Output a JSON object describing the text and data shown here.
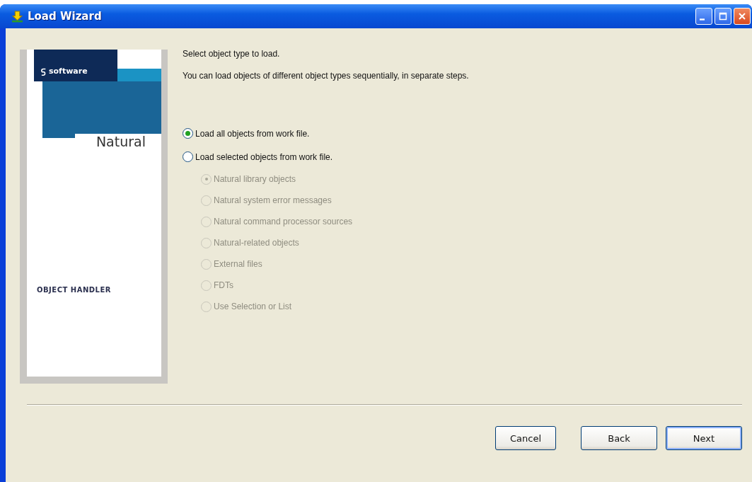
{
  "window": {
    "title": "Load Wizard"
  },
  "brand": {
    "company": "software",
    "product": "Natural",
    "module": "OBJECT HANDLER"
  },
  "heading": "Select object type to load.",
  "description": "You can load objects of different object types sequentially, in separate steps.",
  "options": [
    {
      "label": "Load all objects from work file.",
      "selected": true,
      "disabled": false
    },
    {
      "label": "Load selected objects from work file.",
      "selected": false,
      "disabled": false,
      "children": [
        {
          "label": "Natural library objects",
          "selected": true,
          "disabled": true
        },
        {
          "label": "Natural system error messages",
          "selected": false,
          "disabled": true
        },
        {
          "label": "Natural command processor sources",
          "selected": false,
          "disabled": true
        },
        {
          "label": "Natural-related objects",
          "selected": false,
          "disabled": true
        },
        {
          "label": "External files",
          "selected": false,
          "disabled": true
        },
        {
          "label": "FDTs",
          "selected": false,
          "disabled": true
        },
        {
          "label": "Use Selection or List",
          "selected": false,
          "disabled": true
        }
      ]
    }
  ],
  "buttons": [
    {
      "label": "Cancel",
      "default": false
    },
    {
      "label": "Back",
      "default": false
    },
    {
      "label": "Next",
      "default": true
    }
  ]
}
